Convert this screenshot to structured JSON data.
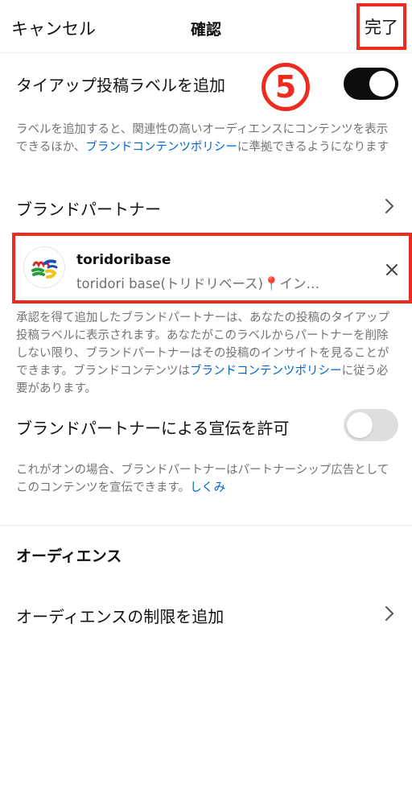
{
  "header": {
    "cancel_label": "キャンセル",
    "title": "確認",
    "done_label": "完了"
  },
  "step_marker": "5",
  "tie_up": {
    "label": "タイアップ投稿ラベルを追加",
    "toggle_on": true,
    "desc_part1": "ラベルを追加すると、関連性の高いオーディエンスにコンテンツを表示できるほか、",
    "desc_link": "ブランドコンテンツポリシー",
    "desc_part2": "に準拠できるようになります"
  },
  "brand_partner": {
    "label": "ブランドパートナー",
    "partner_name": "toridoribase",
    "partner_sub": "toridori base(トリドリベース)📍イン…",
    "desc_part1": "承認を得て追加したブランドパートナーは、あなたの投稿のタイアップ投稿ラベルに表示されます。あなたがこのラベルからパートナーを削除しない限り、ブランドパートナーはその投稿のインサイトを見ることができます。ブランドコンテンツは",
    "desc_link": "ブランドコンテンツポリシー",
    "desc_part2": "に従う必要があります。"
  },
  "promotion": {
    "label": "ブランドパートナーによる宣伝を許可",
    "toggle_on": false,
    "desc_part1": "これがオンの場合、ブランドパートナーはパートナーシップ広告としてこのコンテンツを宣伝できます。",
    "desc_link": "しくみ"
  },
  "audience": {
    "section_title": "オーディエンス",
    "restriction_label": "オーディエンスの制限を追加"
  },
  "colors": {
    "accent_red": "#ee2b1f",
    "link_blue": "#0064d2",
    "toggle_on": "#0d0d0d",
    "toggle_off": "#dedede"
  }
}
